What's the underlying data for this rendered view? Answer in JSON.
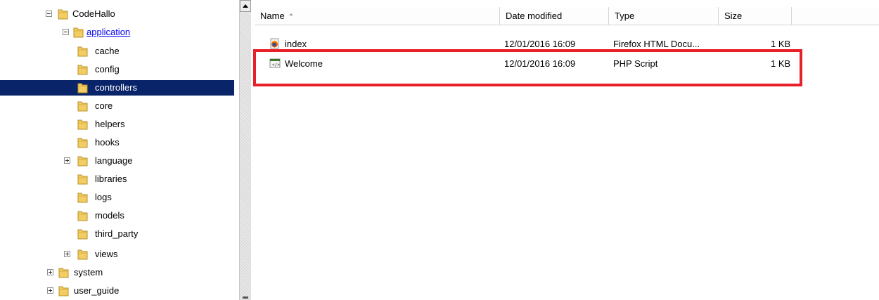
{
  "tree": {
    "items": [
      {
        "label": "CodeHallo",
        "expander": "minus"
      },
      {
        "label": "application",
        "expander": "minus"
      },
      {
        "label": "cache",
        "expander": ""
      },
      {
        "label": "config",
        "expander": ""
      },
      {
        "label": "controllers",
        "expander": "",
        "selected": true
      },
      {
        "label": "core",
        "expander": ""
      },
      {
        "label": "helpers",
        "expander": ""
      },
      {
        "label": "hooks",
        "expander": ""
      },
      {
        "label": "language",
        "expander": "plus"
      },
      {
        "label": "libraries",
        "expander": ""
      },
      {
        "label": "logs",
        "expander": ""
      },
      {
        "label": "models",
        "expander": ""
      },
      {
        "label": "third_party",
        "expander": ""
      },
      {
        "label": "views",
        "expander": "plus"
      },
      {
        "label": "system",
        "expander": "plus"
      },
      {
        "label": "user_guide",
        "expander": "plus"
      }
    ]
  },
  "list": {
    "columns": [
      "Name",
      "Date modified",
      "Type",
      "Size"
    ],
    "files": [
      {
        "name": "index",
        "date": "12/01/2016 16:09",
        "type": "Firefox HTML Docu...",
        "size": "1 KB",
        "icon": "firefox-html-icon"
      },
      {
        "name": "Welcome",
        "date": "12/01/2016 16:09",
        "type": "PHP Script",
        "size": "1 KB",
        "icon": "php-script-icon"
      }
    ]
  },
  "colors": {
    "selection": "#0a246a",
    "highlight": "#e8202a",
    "folder": "#e8c15a"
  }
}
